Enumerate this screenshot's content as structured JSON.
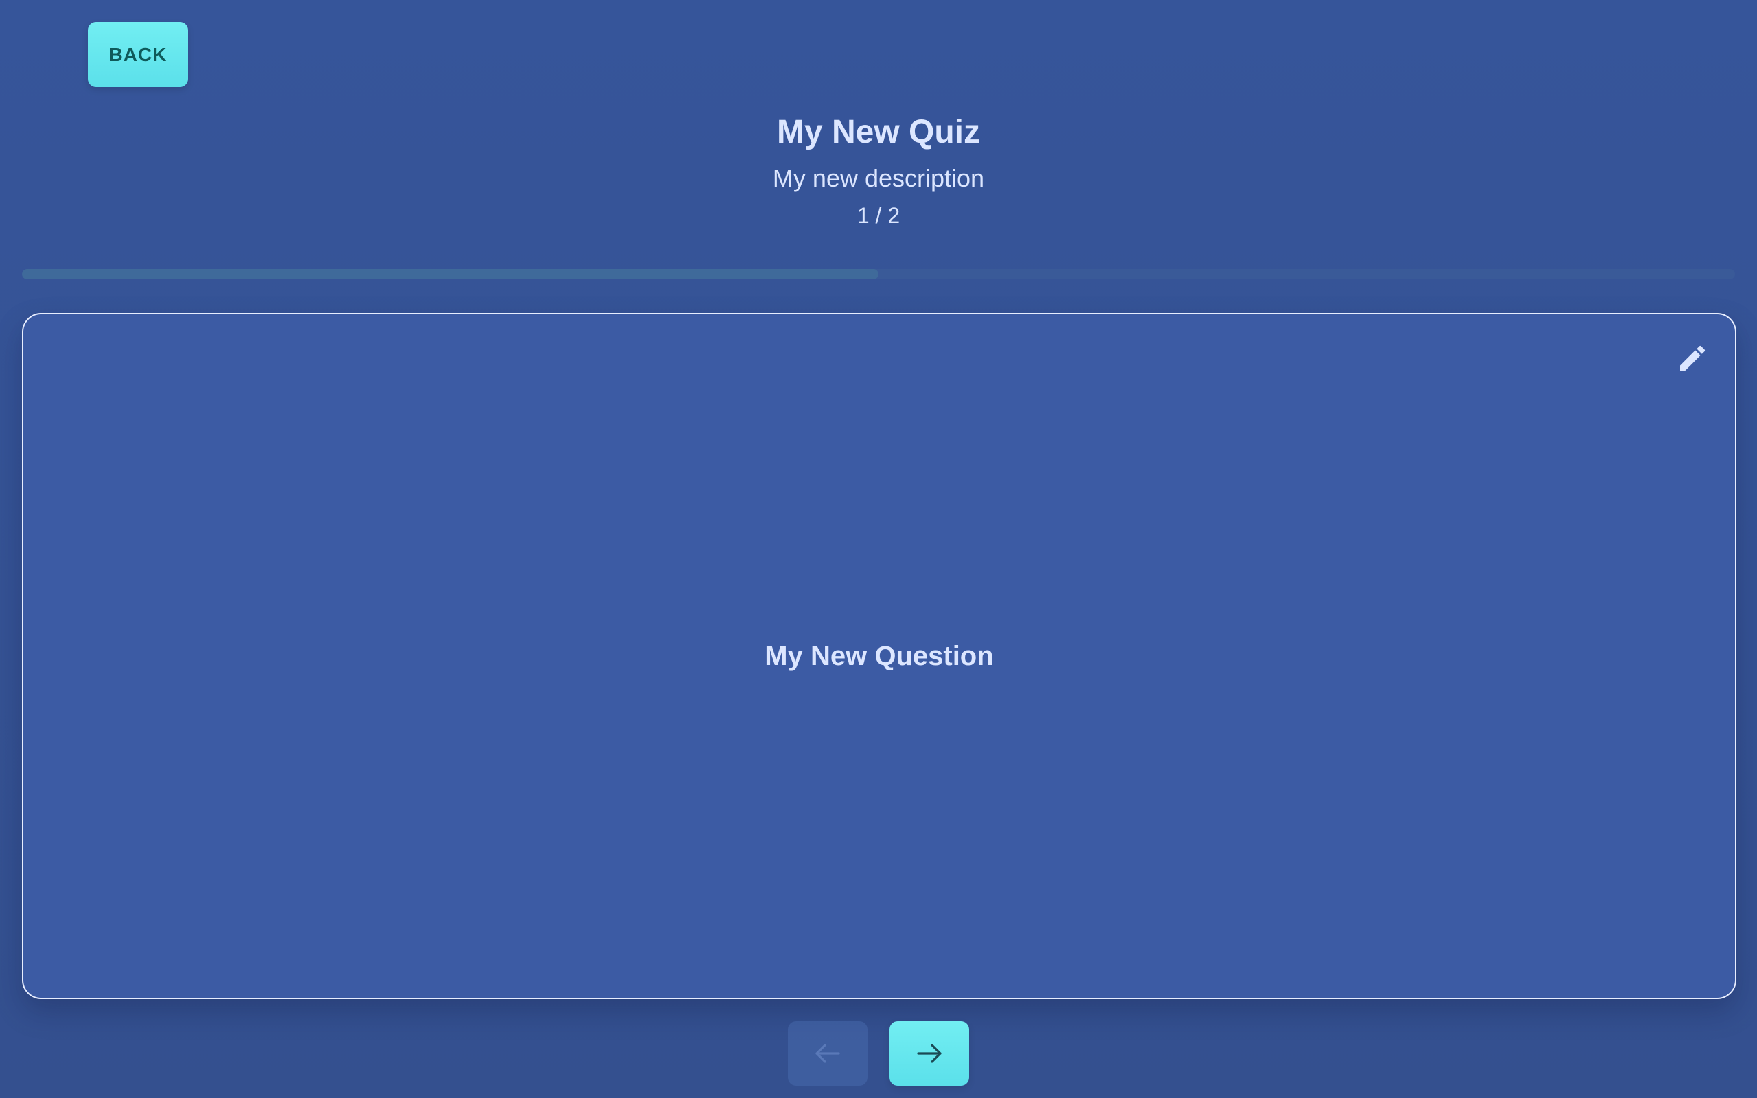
{
  "toolbar": {
    "back_label": "BACK"
  },
  "quiz": {
    "title": "My New Quiz",
    "description": "My new description",
    "counter": "1 / 2",
    "progress_fraction": 0.5
  },
  "question": {
    "text": "My New Question"
  },
  "icons": {
    "edit": "pencil-icon",
    "previous": "arrow-left-icon",
    "next": "arrow-right-icon"
  },
  "colors": {
    "background": "#36559a",
    "card": "#3c5ba4",
    "accent": "#64e7ee",
    "text": "#dce6ff"
  }
}
